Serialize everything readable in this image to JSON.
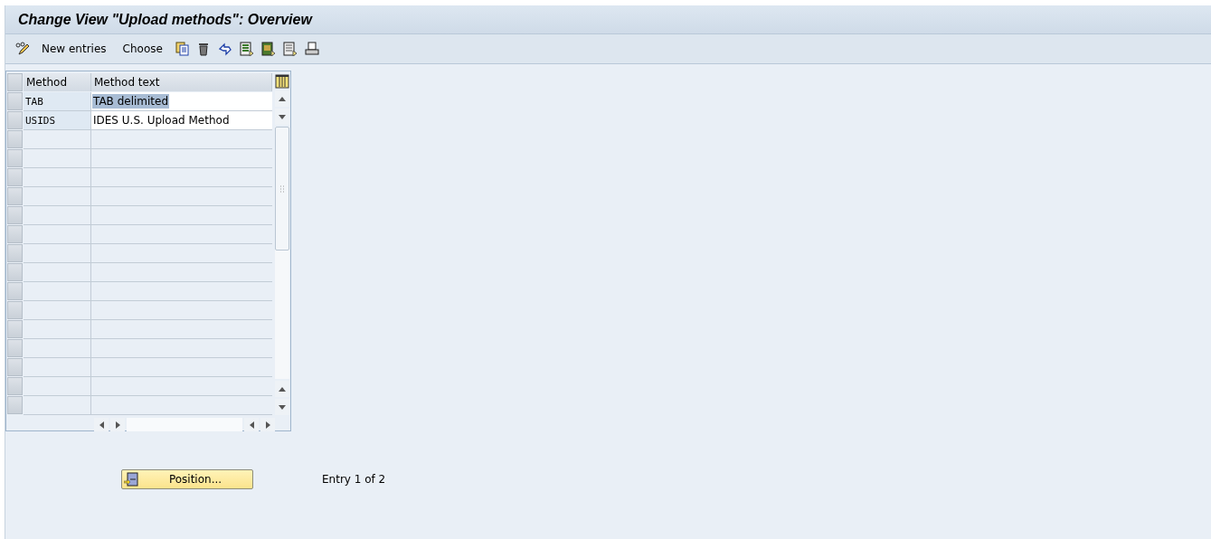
{
  "window": {
    "title": "Change View \"Upload methods\": Overview"
  },
  "toolbar": {
    "items": [
      {
        "kind": "icon"
      },
      {
        "kind": "text",
        "label": "New entries"
      },
      {
        "kind": "text",
        "label": "Choose"
      },
      {
        "kind": "icon"
      },
      {
        "kind": "icon"
      },
      {
        "kind": "icon"
      },
      {
        "kind": "icon"
      },
      {
        "kind": "icon"
      },
      {
        "kind": "icon"
      },
      {
        "kind": "icon"
      }
    ]
  },
  "table": {
    "columns": [
      "Method",
      "Method text"
    ],
    "rows": [
      {
        "cells": [
          "TAB",
          "TAB delimited"
        ],
        "selected": true
      },
      {
        "cells": [
          "USIDS",
          "IDES U.S. Upload Method"
        ],
        "selected": false
      }
    ]
  },
  "position_button": {
    "label": "Position..."
  },
  "entry_info": "Entry 1 of 2"
}
